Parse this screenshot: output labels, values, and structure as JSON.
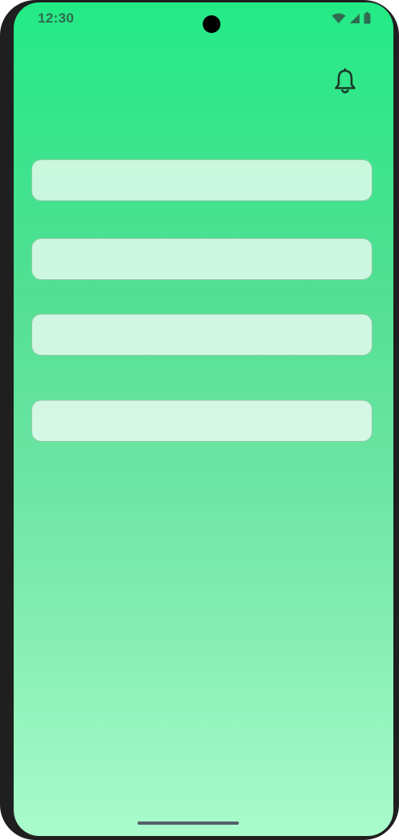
{
  "status_bar": {
    "time": "12:30",
    "icons": [
      "wifi-icon",
      "cellular-signal-icon",
      "battery-icon"
    ]
  },
  "header": {
    "notification_icon": "bell-icon"
  },
  "form": {
    "fields": [
      {
        "value": "",
        "placeholder": ""
      },
      {
        "value": "",
        "placeholder": ""
      },
      {
        "value": "",
        "placeholder": ""
      },
      {
        "value": "",
        "placeholder": ""
      }
    ]
  },
  "colors": {
    "gradient_top": "#23ea86",
    "gradient_bottom": "#a9fbcb",
    "field_background": "#d4f7e4",
    "device_frame": "#1f1f1f"
  }
}
